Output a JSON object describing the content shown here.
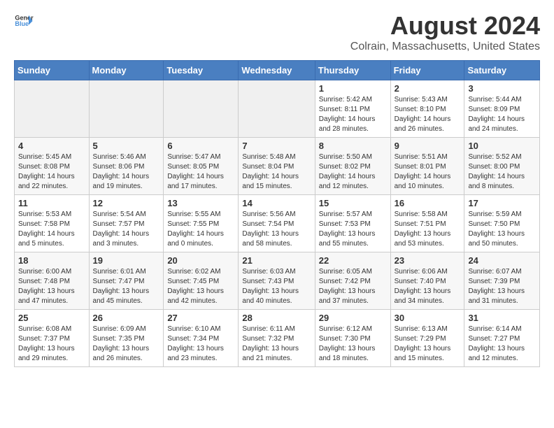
{
  "logo": {
    "general": "General",
    "blue": "Blue"
  },
  "title": "August 2024",
  "subtitle": "Colrain, Massachusetts, United States",
  "weekdays": [
    "Sunday",
    "Monday",
    "Tuesday",
    "Wednesday",
    "Thursday",
    "Friday",
    "Saturday"
  ],
  "weeks": [
    [
      {
        "day": "",
        "info": ""
      },
      {
        "day": "",
        "info": ""
      },
      {
        "day": "",
        "info": ""
      },
      {
        "day": "",
        "info": ""
      },
      {
        "day": "1",
        "info": "Sunrise: 5:42 AM\nSunset: 8:11 PM\nDaylight: 14 hours\nand 28 minutes."
      },
      {
        "day": "2",
        "info": "Sunrise: 5:43 AM\nSunset: 8:10 PM\nDaylight: 14 hours\nand 26 minutes."
      },
      {
        "day": "3",
        "info": "Sunrise: 5:44 AM\nSunset: 8:09 PM\nDaylight: 14 hours\nand 24 minutes."
      }
    ],
    [
      {
        "day": "4",
        "info": "Sunrise: 5:45 AM\nSunset: 8:08 PM\nDaylight: 14 hours\nand 22 minutes."
      },
      {
        "day": "5",
        "info": "Sunrise: 5:46 AM\nSunset: 8:06 PM\nDaylight: 14 hours\nand 19 minutes."
      },
      {
        "day": "6",
        "info": "Sunrise: 5:47 AM\nSunset: 8:05 PM\nDaylight: 14 hours\nand 17 minutes."
      },
      {
        "day": "7",
        "info": "Sunrise: 5:48 AM\nSunset: 8:04 PM\nDaylight: 14 hours\nand 15 minutes."
      },
      {
        "day": "8",
        "info": "Sunrise: 5:50 AM\nSunset: 8:02 PM\nDaylight: 14 hours\nand 12 minutes."
      },
      {
        "day": "9",
        "info": "Sunrise: 5:51 AM\nSunset: 8:01 PM\nDaylight: 14 hours\nand 10 minutes."
      },
      {
        "day": "10",
        "info": "Sunrise: 5:52 AM\nSunset: 8:00 PM\nDaylight: 14 hours\nand 8 minutes."
      }
    ],
    [
      {
        "day": "11",
        "info": "Sunrise: 5:53 AM\nSunset: 7:58 PM\nDaylight: 14 hours\nand 5 minutes."
      },
      {
        "day": "12",
        "info": "Sunrise: 5:54 AM\nSunset: 7:57 PM\nDaylight: 14 hours\nand 3 minutes."
      },
      {
        "day": "13",
        "info": "Sunrise: 5:55 AM\nSunset: 7:55 PM\nDaylight: 14 hours\nand 0 minutes."
      },
      {
        "day": "14",
        "info": "Sunrise: 5:56 AM\nSunset: 7:54 PM\nDaylight: 13 hours\nand 58 minutes."
      },
      {
        "day": "15",
        "info": "Sunrise: 5:57 AM\nSunset: 7:53 PM\nDaylight: 13 hours\nand 55 minutes."
      },
      {
        "day": "16",
        "info": "Sunrise: 5:58 AM\nSunset: 7:51 PM\nDaylight: 13 hours\nand 53 minutes."
      },
      {
        "day": "17",
        "info": "Sunrise: 5:59 AM\nSunset: 7:50 PM\nDaylight: 13 hours\nand 50 minutes."
      }
    ],
    [
      {
        "day": "18",
        "info": "Sunrise: 6:00 AM\nSunset: 7:48 PM\nDaylight: 13 hours\nand 47 minutes."
      },
      {
        "day": "19",
        "info": "Sunrise: 6:01 AM\nSunset: 7:47 PM\nDaylight: 13 hours\nand 45 minutes."
      },
      {
        "day": "20",
        "info": "Sunrise: 6:02 AM\nSunset: 7:45 PM\nDaylight: 13 hours\nand 42 minutes."
      },
      {
        "day": "21",
        "info": "Sunrise: 6:03 AM\nSunset: 7:43 PM\nDaylight: 13 hours\nand 40 minutes."
      },
      {
        "day": "22",
        "info": "Sunrise: 6:05 AM\nSunset: 7:42 PM\nDaylight: 13 hours\nand 37 minutes."
      },
      {
        "day": "23",
        "info": "Sunrise: 6:06 AM\nSunset: 7:40 PM\nDaylight: 13 hours\nand 34 minutes."
      },
      {
        "day": "24",
        "info": "Sunrise: 6:07 AM\nSunset: 7:39 PM\nDaylight: 13 hours\nand 31 minutes."
      }
    ],
    [
      {
        "day": "25",
        "info": "Sunrise: 6:08 AM\nSunset: 7:37 PM\nDaylight: 13 hours\nand 29 minutes."
      },
      {
        "day": "26",
        "info": "Sunrise: 6:09 AM\nSunset: 7:35 PM\nDaylight: 13 hours\nand 26 minutes."
      },
      {
        "day": "27",
        "info": "Sunrise: 6:10 AM\nSunset: 7:34 PM\nDaylight: 13 hours\nand 23 minutes."
      },
      {
        "day": "28",
        "info": "Sunrise: 6:11 AM\nSunset: 7:32 PM\nDaylight: 13 hours\nand 21 minutes."
      },
      {
        "day": "29",
        "info": "Sunrise: 6:12 AM\nSunset: 7:30 PM\nDaylight: 13 hours\nand 18 minutes."
      },
      {
        "day": "30",
        "info": "Sunrise: 6:13 AM\nSunset: 7:29 PM\nDaylight: 13 hours\nand 15 minutes."
      },
      {
        "day": "31",
        "info": "Sunrise: 6:14 AM\nSunset: 7:27 PM\nDaylight: 13 hours\nand 12 minutes."
      }
    ]
  ]
}
